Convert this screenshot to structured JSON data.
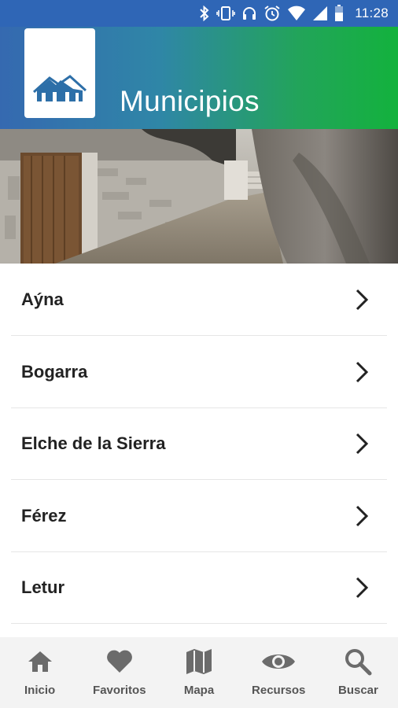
{
  "status_bar": {
    "time": "11:28",
    "icons": [
      "bluetooth-icon",
      "vibrate-icon",
      "headset-icon",
      "alarm-icon",
      "wifi-icon",
      "signal-icon",
      "battery-icon"
    ]
  },
  "header": {
    "title": "Municipios",
    "logo_icon": "houses-logo-icon"
  },
  "municipalities": [
    {
      "name": "Aýna"
    },
    {
      "name": "Bogarra"
    },
    {
      "name": "Elche de la Sierra"
    },
    {
      "name": "Férez"
    },
    {
      "name": "Letur"
    }
  ],
  "bottom_nav": [
    {
      "label": "Inicio",
      "icon": "home-icon"
    },
    {
      "label": "Favoritos",
      "icon": "heart-icon"
    },
    {
      "label": "Mapa",
      "icon": "map-icon"
    },
    {
      "label": "Recursos",
      "icon": "eye-icon"
    },
    {
      "label": "Buscar",
      "icon": "search-icon"
    }
  ],
  "colors": {
    "status_bar": "#2f66b6",
    "header_gradient_start": "#3569b0",
    "header_gradient_end": "#13b23d",
    "nav_icon": "#6b6b6b"
  }
}
